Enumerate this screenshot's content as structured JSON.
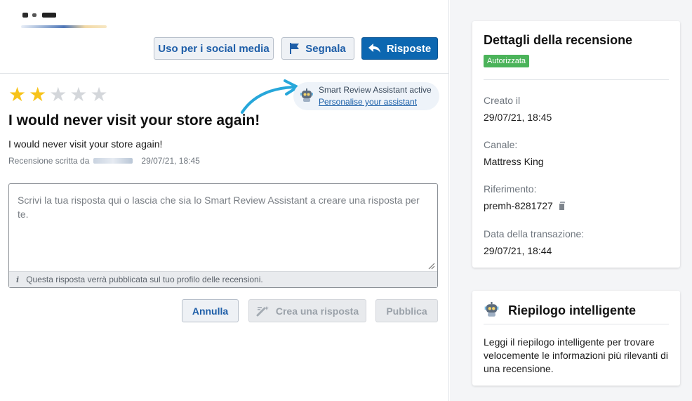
{
  "header": {
    "buttons": {
      "social": "Uso per i social media",
      "report": "Segnala",
      "reply": "Risposte"
    }
  },
  "review": {
    "rating": 2,
    "max_rating": 5,
    "title": "I would never visit your store again!",
    "body": "I would never visit your store again!",
    "written_by_label": "Recensione scritta da",
    "date": "29/07/21, 18:45"
  },
  "assistant": {
    "status": "Smart Review Assistant active",
    "link": "Personalise your assistant"
  },
  "reply": {
    "placeholder": "Scrivi la tua risposta qui o lascia che sia lo Smart Review Assistant a creare una risposta per te.",
    "note": "Questa risposta verrà pubblicata sul tuo profilo delle recensioni.",
    "cancel": "Annulla",
    "generate": "Crea una risposta",
    "publish": "Pubblica"
  },
  "details": {
    "title": "Dettagli della recensione",
    "badge": "Autorizzata",
    "badge_color": "#4bb35a",
    "fields": [
      {
        "label": "Creato il",
        "value": "29/07/21, 18:45"
      },
      {
        "label": "Canale:",
        "value": "Mattress King"
      },
      {
        "label": "Riferimento:",
        "value": "premh-8281727"
      },
      {
        "label": "Data della transazione:",
        "value": "29/07/21, 18:44"
      }
    ]
  },
  "summary": {
    "title": "Riepilogo intelligente",
    "description": "Leggi il riepilogo intelligente per trovare velocemente le informazioni più rilevanti di una recensione."
  },
  "colors": {
    "primary": "#0c67b1",
    "star_on": "#f7c31a",
    "star_off": "#d4d7db",
    "link": "#1a5fa8"
  }
}
